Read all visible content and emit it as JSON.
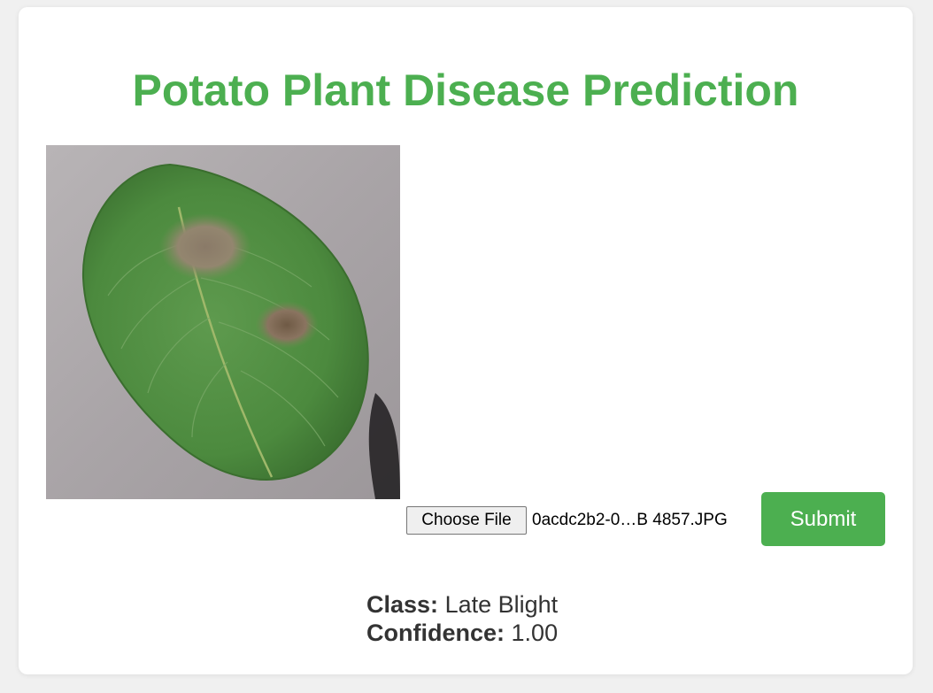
{
  "page": {
    "title": "Potato Plant Disease Prediction",
    "accent_color": "#4caf50",
    "background_color": "#f0f0f0"
  },
  "upload": {
    "choose_file_label": "Choose File",
    "file_name": "0acdc2b2-0…B 4857.JPG",
    "submit_label": "Submit"
  },
  "result": {
    "class_label": "Class:",
    "class_value": "Late Blight",
    "confidence_label": "Confidence:",
    "confidence_value": "1.00"
  },
  "image": {
    "subject": "potato leaf with late blight lesions"
  }
}
